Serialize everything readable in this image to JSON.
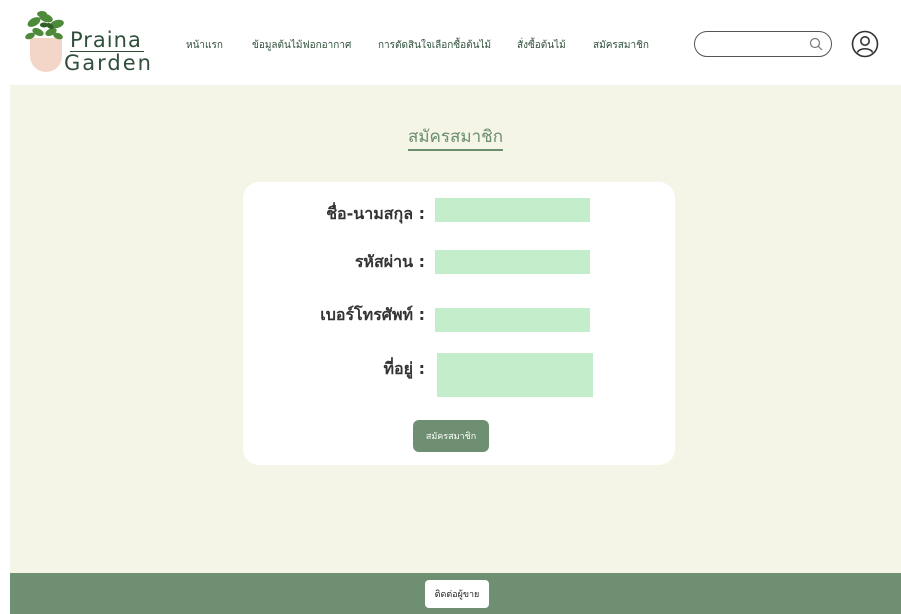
{
  "brand": {
    "line1": "Praina",
    "line2": "Garden"
  },
  "nav": [
    {
      "label": "หน้าแรก"
    },
    {
      "label": "ข้อมูลต้นไม้ฟอกอากาศ"
    },
    {
      "label": "การตัดสินใจเลือกซื้อต้นไม้"
    },
    {
      "label": "สั่งซื้อต้นไม้"
    },
    {
      "label": "สมัครสมาชิก"
    }
  ],
  "search": {
    "value": "",
    "placeholder": ""
  },
  "page": {
    "title": "สมัครสมาชิก"
  },
  "form": {
    "fullname_label": "ชื่อ-นามสกุล :",
    "password_label": "รหัสผ่าน :",
    "phone_label": "เบอร์โทรศัพท์ :",
    "address_label": "ที่อยู่ :",
    "submit_label": "สมัครสมาชิก"
  },
  "footer": {
    "contact_label": "ติดต่อผู้ขาย"
  },
  "colors": {
    "accent": "#6f8f72",
    "field": "#c3edcb",
    "background": "#f4f4e7",
    "pot": "#f4d6c8"
  },
  "icons": {
    "search": "search-icon",
    "user": "user-icon"
  }
}
